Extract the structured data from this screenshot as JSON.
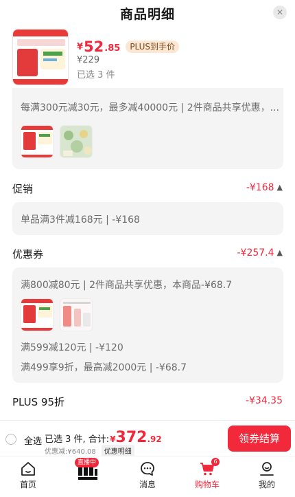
{
  "header": {
    "title": "商品明细",
    "close_icon": "close-icon"
  },
  "product": {
    "price_symbol": "¥",
    "price_int": "52",
    "price_dec": ".85",
    "plus_badge": "PLUS到手价",
    "original_price": "¥229",
    "selected_count": "已选 3 件"
  },
  "full_reduction": {
    "text": "每满300元减30元，最多减40000元 | 2件商品共享优惠，..."
  },
  "promotion": {
    "label": "促销",
    "amount": "-¥168",
    "detail": "单品满3件减168元 | -¥168"
  },
  "coupons": {
    "label": "优惠券",
    "amount": "-¥257.4",
    "items": [
      "满800减80元 | 2件商品共享优惠，本商品-¥68.7",
      "满599减120元 | -¥120",
      "满499享9折，最高减2000元 | -¥68.7"
    ]
  },
  "plus_discount": {
    "label": "PLUS 95折",
    "amount": "-¥34.35"
  },
  "bottom_bar": {
    "select_all": "全选",
    "summary_prefix": "已选 3 件, 合计:",
    "total_symbol": "¥",
    "total_int": "372",
    "total_dec": ".92",
    "discount_text": "优惠减:¥640.08",
    "detail_link": "优惠明细",
    "checkout": "领券结算"
  },
  "tab_bar": {
    "tabs": [
      {
        "label": "首页",
        "icon": "home-icon"
      },
      {
        "label": "",
        "icon": "live-icon",
        "badge": "直播中"
      },
      {
        "label": "消息",
        "icon": "message-icon"
      },
      {
        "label": "购物车",
        "icon": "cart-icon",
        "badge": "6"
      },
      {
        "label": "我的",
        "icon": "profile-icon"
      }
    ]
  },
  "colors": {
    "accent": "#f0283c",
    "plus_bg": "#fbe7d3",
    "card_bg": "#f4f4f4"
  }
}
